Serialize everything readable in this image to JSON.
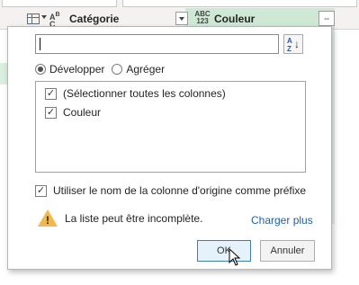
{
  "header": {
    "col1_name": "Catégorie",
    "col2_name": "Couleur",
    "col1_type_icon": "ABC",
    "col2_type_icon": "ABC 123"
  },
  "popup": {
    "search": {
      "value": "",
      "placeholder": ""
    },
    "sort_icon": "sort-az-icon",
    "mode": {
      "expand_label": "Développer",
      "aggregate_label": "Agréger",
      "selected": "Développer"
    },
    "columns": [
      {
        "label": "(Sélectionner toutes les colonnes)",
        "checked": true
      },
      {
        "label": "Couleur",
        "checked": true
      }
    ],
    "prefix_label": "Utiliser le nom de la colonne d'origine comme préfixe",
    "prefix_checked": true,
    "warning_text": "La liste peut être incomplète.",
    "load_more_label": "Charger plus",
    "ok_label": "OK",
    "cancel_label": "Annuler"
  },
  "colors": {
    "accent_column": "#e8f4ec",
    "link": "#1f5fa8",
    "warning": "#f2b84b"
  }
}
